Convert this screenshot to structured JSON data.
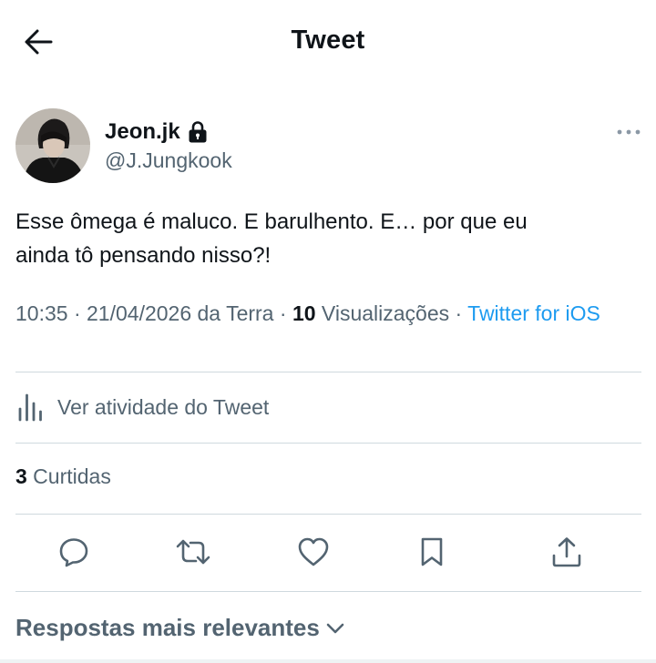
{
  "header": {
    "title": "Tweet",
    "back_icon": "arrow-left-icon"
  },
  "author": {
    "display_name": "Jeon.jk",
    "handle": "@J.Jungkook",
    "protected_icon": "lock-icon",
    "more_icon": "more-dots-icon"
  },
  "tweet": {
    "text_line1": "Esse ômega é maluco. E barulhento. E… por que eu",
    "text_line2": "ainda tô pensando nisso?!"
  },
  "meta": {
    "time": "10:35",
    "sep1": " · ",
    "date": "21/04/2026 da Terra",
    "sep2": " · ",
    "views_count": "10",
    "views_label": " Visualizações",
    "sep3": " · ",
    "source": "Twitter for iOS"
  },
  "activity": {
    "label": "Ver atividade do Tweet",
    "icon": "chart-bars-icon"
  },
  "likes": {
    "count": "3",
    "label": " Curtidas"
  },
  "actions": [
    {
      "name": "reply",
      "icon": "reply-icon"
    },
    {
      "name": "retweet",
      "icon": "retweet-icon"
    },
    {
      "name": "like",
      "icon": "heart-icon"
    },
    {
      "name": "bookmark",
      "icon": "bookmark-icon"
    },
    {
      "name": "share",
      "icon": "share-icon"
    }
  ],
  "replies": {
    "label": "Respostas mais relevantes",
    "icon": "chevron-down-icon"
  },
  "colors": {
    "link": "#1d9bf0",
    "secondary": "#536471",
    "primary": "#0f1419",
    "divider": "#cfd9de"
  }
}
